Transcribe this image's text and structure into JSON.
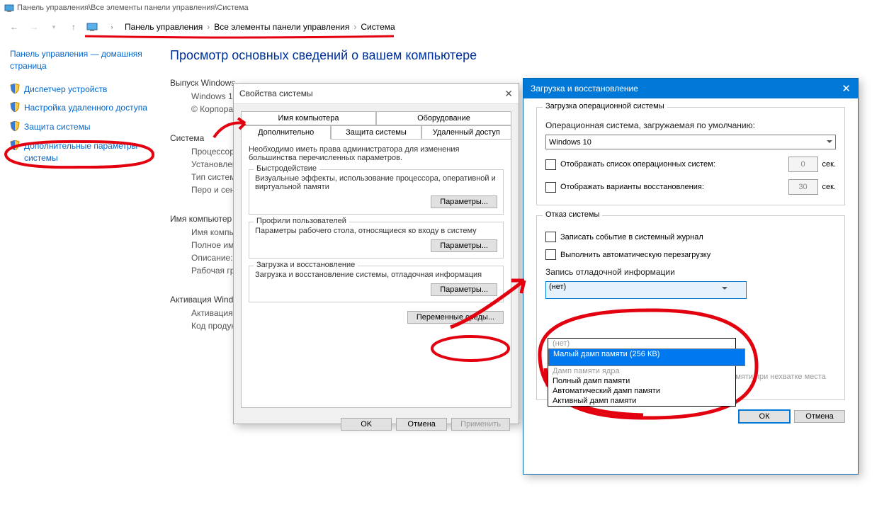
{
  "window": {
    "title": "Панель управления\\Все элементы панели управления\\Система"
  },
  "breadcrumb": {
    "a": "Панель управления",
    "b": "Все элементы панели управления",
    "c": "Система"
  },
  "sidebar": {
    "home": "Панель управления — домашняя страница",
    "items": [
      "Диспетчер устройств",
      "Настройка удаленного доступа",
      "Защита системы",
      "Дополнительные параметры системы"
    ]
  },
  "content": {
    "heading": "Просмотр основных сведений о вашем компьютере",
    "sec1": "Выпуск Windows",
    "win": "Windows 10",
    "corp": "© Корпорац",
    "sec2": "Система",
    "f1": "Процессор:",
    "f2": "Установленн (ОЗУ):",
    "f3": "Тип системы",
    "f4": "Перо и сенс",
    "sec3": "Имя компьютер",
    "f5": "Имя компью",
    "f6": "Полное имя",
    "f7": "Описание:",
    "f8": "Рабочая гру",
    "sec4": "Активация Wind",
    "f9": "Активация W",
    "f10": "Код продукт"
  },
  "dlg1": {
    "title": "Свойства системы",
    "tabs": {
      "t1": "Имя компьютера",
      "t2": "Оборудование",
      "t3": "Дополнительно",
      "t4": "Защита системы",
      "t5": "Удаленный доступ"
    },
    "note": "Необходимо иметь права администратора для изменения большинства перечисленных параметров.",
    "g1t": "Быстродействие",
    "g1d": "Визуальные эффекты, использование процессора, оперативной и виртуальной памяти",
    "g2t": "Профили пользователей",
    "g2d": "Параметры рабочего стола, относящиеся ко входу в систему",
    "g3t": "Загрузка и восстановление",
    "g3d": "Загрузка и восстановление системы, отладочная информация",
    "params": "Параметры...",
    "env": "Переменные среды...",
    "ok": "OK",
    "cancel": "Отмена",
    "apply": "Применить"
  },
  "dlg2": {
    "title": "Загрузка и восстановление",
    "g1t": "Загрузка операционной системы",
    "l1": "Операционная система, загружаемая по умолчанию:",
    "os": "Windows 10",
    "c1": "Отображать список операционных систем:",
    "c2": "Отображать варианты восстановления:",
    "v1": "0",
    "v2": "30",
    "sec": "сек.",
    "g2t": "Отказ системы",
    "c3": "Записать событие в системный журнал",
    "c4": "Выполнить автоматическую перезагрузку",
    "l2": "Запись отладочной информации",
    "selval": "(нет)",
    "opts": [
      "(нет)",
      "Малый дамп памяти (256 КВ)",
      "Дамп памяти ядра",
      "Полный дамп памяти",
      "Автоматический дамп памяти",
      "Активный дамп памяти"
    ],
    "c5": "Отключить автоматическое удаление дампов памяти при нехватке места на диске",
    "ok": "ОК",
    "cancel": "Отмена"
  }
}
